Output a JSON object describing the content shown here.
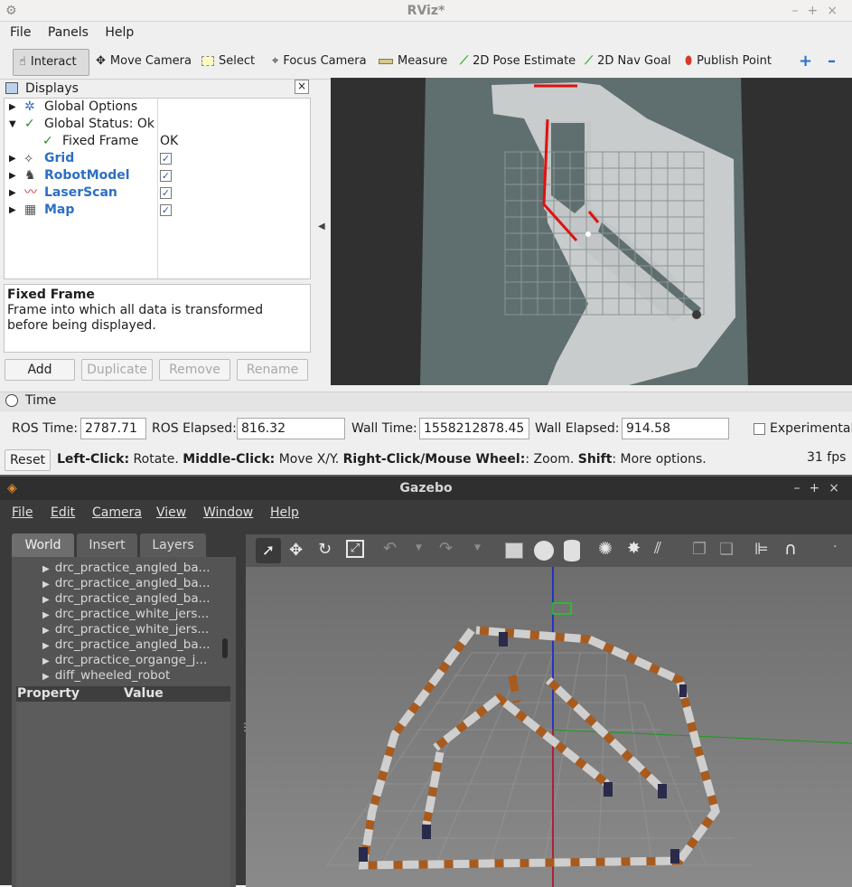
{
  "rviz": {
    "window_title": "RViz*",
    "menu": [
      "File",
      "Panels",
      "Help"
    ],
    "toolbar": {
      "interact": "Interact",
      "move_camera": "Move Camera",
      "select": "Select",
      "focus_camera": "Focus Camera",
      "measure": "Measure",
      "pose_estimate": "2D Pose Estimate",
      "nav_goal": "2D Nav Goal",
      "publish_point": "Publish Point"
    },
    "displays": {
      "title": "Displays",
      "items": [
        {
          "label": "Global Options"
        },
        {
          "label": "Global Status: Ok"
        },
        {
          "label": "Fixed Frame",
          "value": "OK"
        },
        {
          "label": "Grid",
          "checked": true
        },
        {
          "label": "RobotModel",
          "checked": true
        },
        {
          "label": "LaserScan",
          "checked": true
        },
        {
          "label": "Map",
          "checked": true
        }
      ],
      "desc_title": "Fixed Frame",
      "desc_text": "Frame into which all data is transformed before being displayed.",
      "buttons": {
        "add": "Add",
        "duplicate": "Duplicate",
        "remove": "Remove",
        "rename": "Rename"
      }
    },
    "time": {
      "title": "Time",
      "ros_time_label": "ROS Time:",
      "ros_time": "2787.71",
      "ros_elapsed_label": "ROS Elapsed:",
      "ros_elapsed": "816.32",
      "wall_time_label": "Wall Time:",
      "wall_time": "1558212878.45",
      "wall_elapsed_label": "Wall Elapsed:",
      "wall_elapsed": "914.58",
      "experimental": "Experimental"
    },
    "status": {
      "reset": "Reset",
      "lc": "Left-Click:",
      "lc_t": " Rotate. ",
      "mc": "Middle-Click:",
      "mc_t": " Move X/Y. ",
      "rc": "Right-Click/Mouse Wheel:",
      "rc_t": ": Zoom. ",
      "sh": "Shift",
      "sh_t": ": More options.",
      "fps": "31 fps"
    }
  },
  "gazebo": {
    "window_title": "Gazebo",
    "menu": [
      "File",
      "Edit",
      "Camera",
      "View",
      "Window",
      "Help"
    ],
    "tabs": [
      "World",
      "Insert",
      "Layers"
    ],
    "models": [
      "drc_practice_angled_ba...",
      "drc_practice_angled_ba...",
      "drc_practice_angled_ba...",
      "drc_practice_white_jers...",
      "drc_practice_white_jers...",
      "drc_practice_angled_ba...",
      "drc_practice_organge_j...",
      "diff_wheeled_robot"
    ],
    "property_header": "Property",
    "value_header": "Value"
  }
}
